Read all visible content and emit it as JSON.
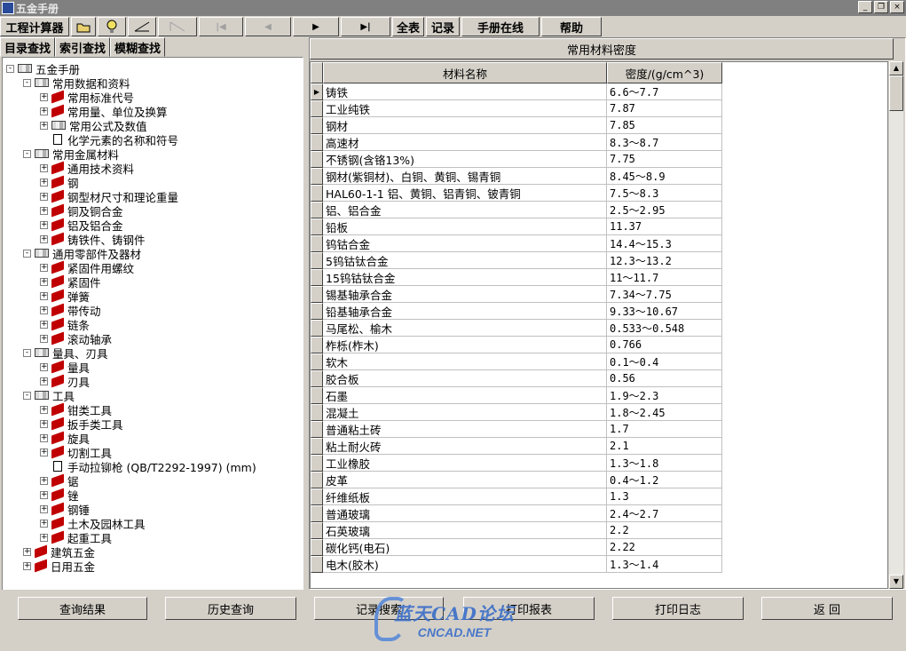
{
  "window": {
    "title": "五金手册",
    "controls": [
      "_",
      "❐",
      "×"
    ]
  },
  "toolbar": {
    "calc_label": "工程计算器",
    "icons": [
      "folder-icon",
      "bulb-icon",
      "line-icon",
      "diagonal-icon",
      "first-icon",
      "prev-icon",
      "next-icon",
      "last-icon"
    ],
    "glyphs": {
      "first": "|◀",
      "prev": "◀",
      "next": "▶",
      "last": "▶|"
    },
    "full_table_label": "全表",
    "record_label": "记录",
    "online_label": "手册在线",
    "help_label": "帮助"
  },
  "left_tabs": [
    "目录查找",
    "索引查找",
    "模糊查找"
  ],
  "tree": [
    {
      "label": "五金手册",
      "level": 0,
      "exp": "-",
      "icon": "books"
    },
    {
      "label": "常用数据和资料",
      "level": 1,
      "exp": "-",
      "icon": "books"
    },
    {
      "label": "常用标准代号",
      "level": 2,
      "exp": "+",
      "icon": "book"
    },
    {
      "label": "常用量、单位及换算",
      "level": 2,
      "exp": "+",
      "icon": "book"
    },
    {
      "label": "常用公式及数值",
      "level": 2,
      "exp": "+",
      "icon": "books"
    },
    {
      "label": "化学元素的名称和符号",
      "level": 2,
      "exp": "",
      "icon": "doc"
    },
    {
      "label": "常用金属材料",
      "level": 1,
      "exp": "-",
      "icon": "books"
    },
    {
      "label": "通用技术资料",
      "level": 2,
      "exp": "+",
      "icon": "book"
    },
    {
      "label": "钢",
      "level": 2,
      "exp": "+",
      "icon": "book"
    },
    {
      "label": "钢型材尺寸和理论重量",
      "level": 2,
      "exp": "+",
      "icon": "book"
    },
    {
      "label": "铜及铜合金",
      "level": 2,
      "exp": "+",
      "icon": "book"
    },
    {
      "label": "铝及铝合金",
      "level": 2,
      "exp": "+",
      "icon": "book"
    },
    {
      "label": "铸铁件、铸钢件",
      "level": 2,
      "exp": "+",
      "icon": "book"
    },
    {
      "label": "通用零部件及器材",
      "level": 1,
      "exp": "-",
      "icon": "books"
    },
    {
      "label": "紧固件用螺纹",
      "level": 2,
      "exp": "+",
      "icon": "book"
    },
    {
      "label": "紧固件",
      "level": 2,
      "exp": "+",
      "icon": "book"
    },
    {
      "label": "弹簧",
      "level": 2,
      "exp": "+",
      "icon": "book"
    },
    {
      "label": "带传动",
      "level": 2,
      "exp": "+",
      "icon": "book"
    },
    {
      "label": "链条",
      "level": 2,
      "exp": "+",
      "icon": "book"
    },
    {
      "label": "滚动轴承",
      "level": 2,
      "exp": "+",
      "icon": "book"
    },
    {
      "label": "量具、刃具",
      "level": 1,
      "exp": "-",
      "icon": "books"
    },
    {
      "label": "量具",
      "level": 2,
      "exp": "+",
      "icon": "book"
    },
    {
      "label": "刃具",
      "level": 2,
      "exp": "+",
      "icon": "book"
    },
    {
      "label": "工具",
      "level": 1,
      "exp": "-",
      "icon": "books"
    },
    {
      "label": "钳类工具",
      "level": 2,
      "exp": "+",
      "icon": "book"
    },
    {
      "label": "扳手类工具",
      "level": 2,
      "exp": "+",
      "icon": "book"
    },
    {
      "label": "旋具",
      "level": 2,
      "exp": "+",
      "icon": "book"
    },
    {
      "label": "切割工具",
      "level": 2,
      "exp": "+",
      "icon": "book"
    },
    {
      "label": "手动拉铆枪 (QB/T2292-1997)  (mm)",
      "level": 2,
      "exp": "",
      "icon": "doc"
    },
    {
      "label": "锯",
      "level": 2,
      "exp": "+",
      "icon": "book"
    },
    {
      "label": "锉",
      "level": 2,
      "exp": "+",
      "icon": "book"
    },
    {
      "label": "钢锤",
      "level": 2,
      "exp": "+",
      "icon": "book"
    },
    {
      "label": "土木及园林工具",
      "level": 2,
      "exp": "+",
      "icon": "book"
    },
    {
      "label": "起重工具",
      "level": 2,
      "exp": "+",
      "icon": "book"
    },
    {
      "label": "建筑五金",
      "level": 1,
      "exp": "+",
      "icon": "book"
    },
    {
      "label": "日用五金",
      "level": 1,
      "exp": "+",
      "icon": "book"
    }
  ],
  "table": {
    "title": "常用材料密度",
    "columns": [
      "材料名称",
      "密度/(g/cm^3)"
    ],
    "rows": [
      [
        "铸铁",
        "6.6～7.7"
      ],
      [
        "工业纯铁",
        "7.87"
      ],
      [
        "钢材",
        "7.85"
      ],
      [
        "高速材",
        "8.3～8.7"
      ],
      [
        "不锈钢(含铬13%)",
        "7.75"
      ],
      [
        "钢材(紫铜材)、白铜、黄铜、锡青铜",
        "8.45～8.9"
      ],
      [
        "HAL60-1-1 铝、黄铜、铝青铜、铍青铜",
        "7.5～8.3"
      ],
      [
        "铝、铝合金",
        "2.5～2.95"
      ],
      [
        "铅板",
        "11.37"
      ],
      [
        "钨钴合金",
        "14.4～15.3"
      ],
      [
        "5钨钴钛合金",
        "12.3～13.2"
      ],
      [
        "15钨钴钛合金",
        "11～11.7"
      ],
      [
        "锡基轴承合金",
        "7.34～7.75"
      ],
      [
        "铅基轴承合金",
        "9.33～10.67"
      ],
      [
        "马尾松、榆木",
        "0.533～0.548"
      ],
      [
        "柞栎(柞木)",
        "0.766"
      ],
      [
        "软木",
        "0.1～0.4"
      ],
      [
        "胶合板",
        "0.56"
      ],
      [
        "石墨",
        "1.9～2.3"
      ],
      [
        "混凝土",
        "1.8～2.45"
      ],
      [
        "普通粘土砖",
        "1.7"
      ],
      [
        "粘土耐火砖",
        "2.1"
      ],
      [
        "工业橡胶",
        "1.3～1.8"
      ],
      [
        "皮革",
        "0.4～1.2"
      ],
      [
        "纤维纸板",
        "1.3"
      ],
      [
        "普通玻璃",
        "2.4～2.7"
      ],
      [
        "石英玻璃",
        "2.2"
      ],
      [
        "碳化钙(电石)",
        "2.22"
      ],
      [
        "电木(胶木)",
        "1.3～1.4"
      ]
    ]
  },
  "bottom_buttons": [
    "查询结果",
    "历史查询",
    "记录搜索",
    "打印报表",
    "打印日志",
    "返 回"
  ],
  "watermark": {
    "line1": "蓝天CAD论坛",
    "line2": "CNCAD.NET"
  }
}
